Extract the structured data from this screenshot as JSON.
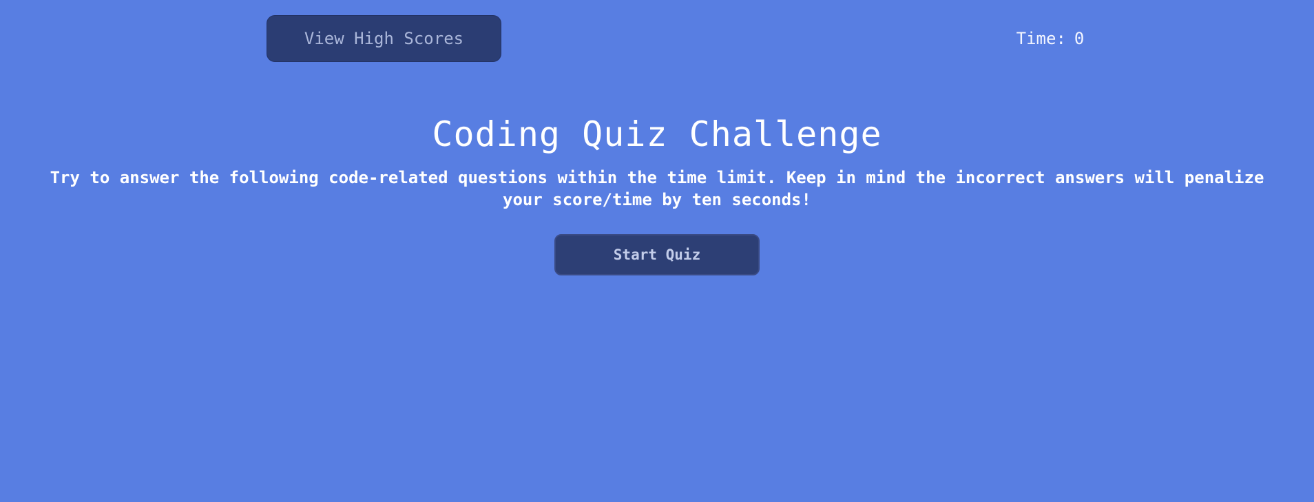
{
  "header": {
    "high_scores_label": "View High Scores",
    "timer_label": "Time:",
    "timer_value": "0"
  },
  "main": {
    "title": "Coding Quiz Challenge",
    "intro": "Try to answer the following code-related questions within the time limit. Keep in mind the incorrect answers will penalize your score/time by ten seconds!",
    "start_label": "Start Quiz"
  },
  "colors": {
    "background": "#587ee2",
    "button_bg": "#2b3d73",
    "button_text": "#aab6d9",
    "text": "#ffffff"
  }
}
